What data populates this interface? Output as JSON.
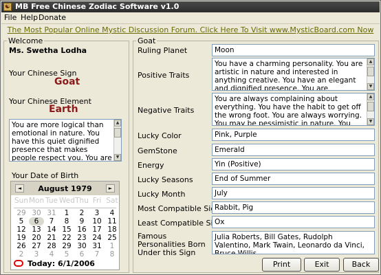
{
  "window": {
    "title": "MB Free Chinese Zodiac Software v1.0",
    "icon": "yin-yang-icon"
  },
  "menu": [
    "File",
    "Help",
    "Donate"
  ],
  "banner": {
    "text": "The Most Popular Online Mystic Discussion Forum. Click Here To Visit www.MysticBoard.com Now"
  },
  "welcome": {
    "group_label": "Welcome",
    "user_name": "Ms. Swetha Lodha",
    "sign_label": "Your Chinese Sign",
    "sign_value": "Goat",
    "element_label": "Your Chinese Element",
    "element_value": "Earth",
    "element_desc": "You are more logical than emotional in nature. You have this quiet dignified presence that makes people respect you. You are prudent and in",
    "dob_label": "Your Date of Birth"
  },
  "calendar": {
    "month": "August 1979",
    "prev": "◄",
    "next": "►",
    "days_of_week": [
      "Sun",
      "Mon",
      "Tue",
      "Wed",
      "Thu",
      "Fri",
      "Sat"
    ],
    "weeks": [
      [
        "29",
        "30",
        "31",
        "1",
        "2",
        "3",
        "4"
      ],
      [
        "5",
        "6",
        "7",
        "8",
        "9",
        "10",
        "11"
      ],
      [
        "12",
        "13",
        "14",
        "15",
        "16",
        "17",
        "18"
      ],
      [
        "19",
        "20",
        "21",
        "22",
        "23",
        "24",
        "25"
      ],
      [
        "26",
        "27",
        "28",
        "29",
        "30",
        "31",
        "1"
      ],
      [
        "2",
        "3",
        "4",
        "5",
        "6",
        "7",
        "8"
      ]
    ],
    "selected_day": "6",
    "today": "Today: 6/1/2006"
  },
  "details": {
    "group_label": "Goat",
    "rows": [
      {
        "label": "Ruling Planet",
        "value": "Moon"
      },
      {
        "label": "Positive Traits",
        "value": "You have a charming personality. You are artistic in nature and interested in anything creative. You have an elegant and dignified presence. You are considered to be lucky and"
      },
      {
        "label": "Negative Traits",
        "value": "You are always complaining about everything. You have the habit to get off the wrong foot. You are always worrying. You may be pessimistic in nature. You can't do without"
      },
      {
        "label": "Lucky Color",
        "value": "Pink, Purple"
      },
      {
        "label": "GemStone",
        "value": "Emerald"
      },
      {
        "label": "Energy",
        "value": "Yin (Positive)"
      },
      {
        "label": "Lucky Seasons",
        "value": "End of Summer"
      },
      {
        "label": "Lucky Month",
        "value": "July"
      },
      {
        "label": "Most Compatible Sign",
        "value": "Rabbit, Pig"
      },
      {
        "label": "Least Compatible Sign",
        "value": "Ox"
      },
      {
        "label": "Famous Personalities Born Under this Sign",
        "value": "Julia Roberts, Bill Gates, Rudolph Valentino, Mark Twain, Leonardo da Vinci, Bruce Willis"
      }
    ]
  },
  "buttons": {
    "print": "Print",
    "exit": "Exit",
    "back": "Back"
  }
}
